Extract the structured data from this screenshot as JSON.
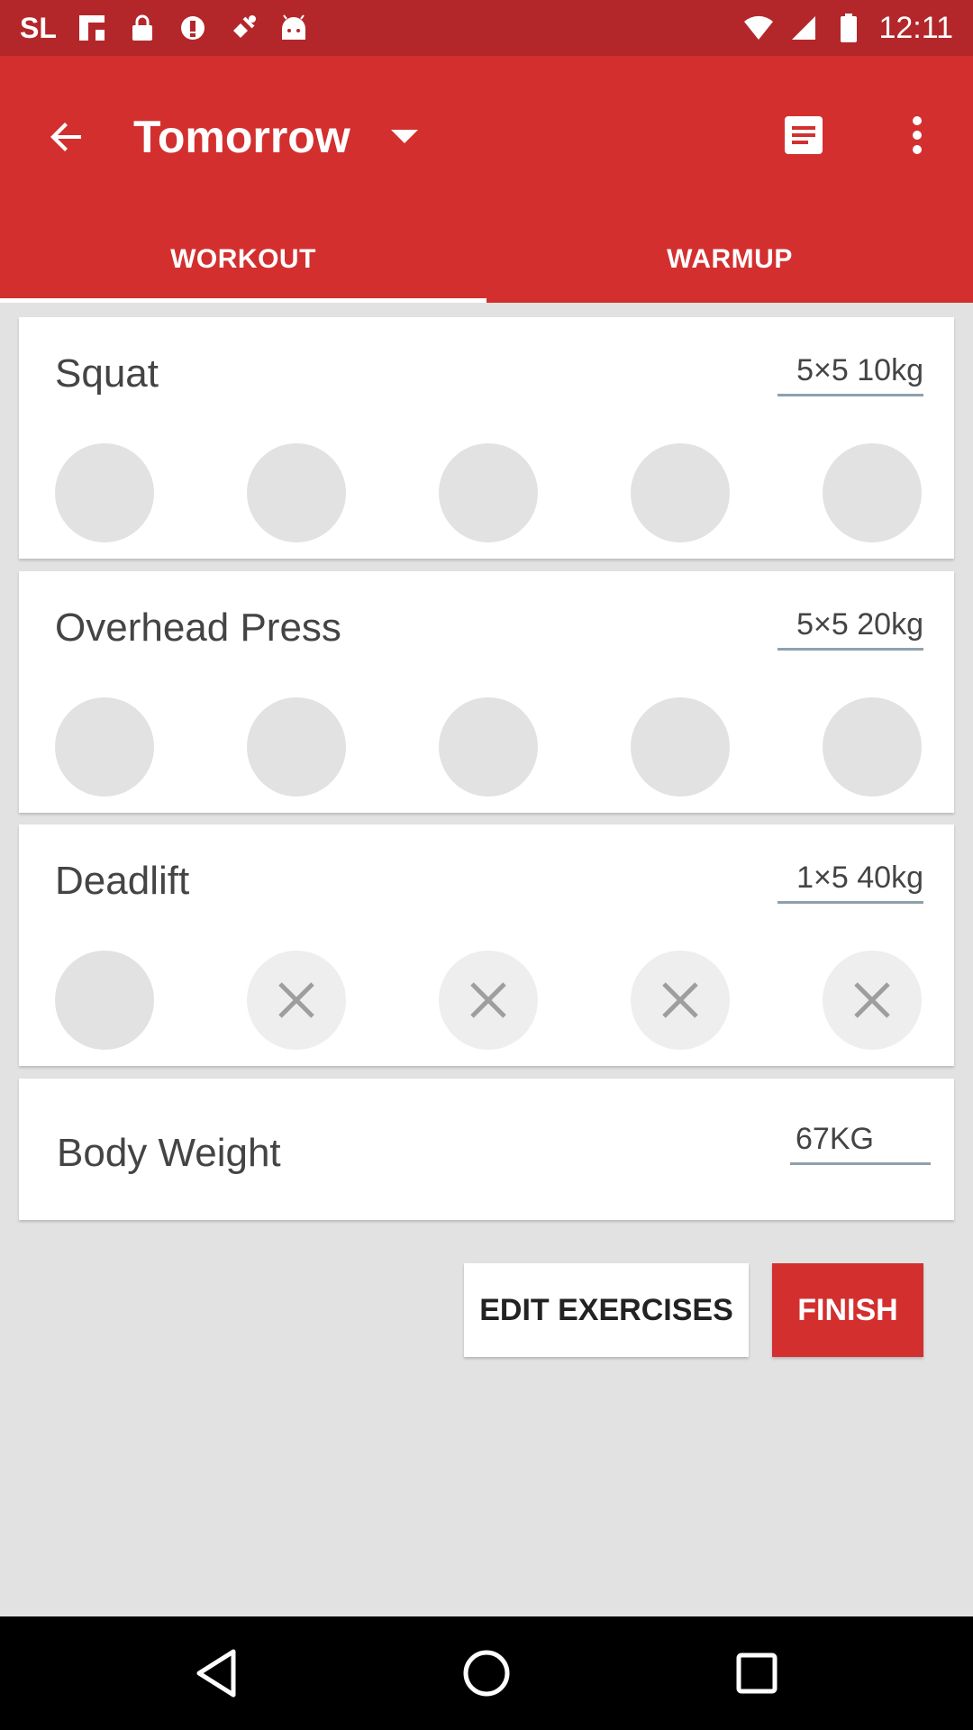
{
  "status_bar": {
    "carrier": "SL",
    "time": "12:11"
  },
  "toolbar": {
    "title": "Tomorrow",
    "accent_color": "#d32f2f"
  },
  "tabs": [
    {
      "label": "WORKOUT",
      "active": true
    },
    {
      "label": "WARMUP",
      "active": false
    }
  ],
  "exercises": [
    {
      "name": "Squat",
      "scheme": "5×5 10kg",
      "sets": [
        "empty",
        "empty",
        "empty",
        "empty",
        "empty"
      ]
    },
    {
      "name": "Overhead Press",
      "scheme": "5×5 20kg",
      "sets": [
        "empty",
        "empty",
        "empty",
        "empty",
        "empty"
      ]
    },
    {
      "name": "Deadlift",
      "scheme": "1×5 40kg",
      "sets": [
        "empty",
        "disabled",
        "disabled",
        "disabled",
        "disabled"
      ]
    }
  ],
  "body_weight": {
    "label": "Body Weight",
    "value": "67KG"
  },
  "actions": {
    "edit_label": "EDIT EXERCISES",
    "finish_label": "FINISH"
  }
}
